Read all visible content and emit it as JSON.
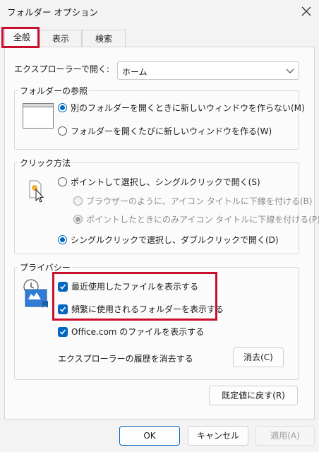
{
  "window": {
    "title": "フォルダー オプション",
    "close_icon": "close-icon"
  },
  "tabs": [
    {
      "label": "全般",
      "active": true
    },
    {
      "label": "表示",
      "active": false
    },
    {
      "label": "検索",
      "active": false
    }
  ],
  "general": {
    "open_label": "エクスプローラーで開く:",
    "open_value": "ホーム",
    "browse_group": {
      "legend": "フォルダーの参照",
      "options": [
        {
          "label": "別のフォルダーを開くときに新しいウィンドウを作らない(M)",
          "selected": true
        },
        {
          "label": "フォルダーを開くたびに新しいウィンドウを作る(W)",
          "selected": false
        }
      ]
    },
    "click_group": {
      "legend": "クリック方法",
      "option_single": "ポイントして選択し、シングルクリックで開く(S)",
      "sub_options": [
        {
          "label": "ブラウザーのように、アイコン タイトルに下線を付ける(B)",
          "selected": false,
          "disabled": true
        },
        {
          "label": "ポイントしたときにのみアイコン タイトルに下線を付ける(P)",
          "selected": true,
          "disabled": true
        }
      ],
      "option_double": "シングルクリックで選択し、ダブルクリックで開く(D)",
      "double_selected": true
    },
    "privacy_group": {
      "legend": "プライバシー",
      "checks": [
        {
          "label": "最近使用したファイルを表示する",
          "checked": true
        },
        {
          "label": "頻繁に使用されるフォルダーを表示する",
          "checked": true
        },
        {
          "label": "Office.com のファイルを表示する",
          "checked": true
        }
      ],
      "history_label": "エクスプローラーの履歴を消去する",
      "clear_button": "消去(C)"
    },
    "restore_button": "既定値に戻す(R)"
  },
  "footer": {
    "ok": "OK",
    "cancel": "キャンセル",
    "apply": "適用(A)"
  },
  "colors": {
    "accent": "#0067c0",
    "highlight": "#c8102e"
  }
}
